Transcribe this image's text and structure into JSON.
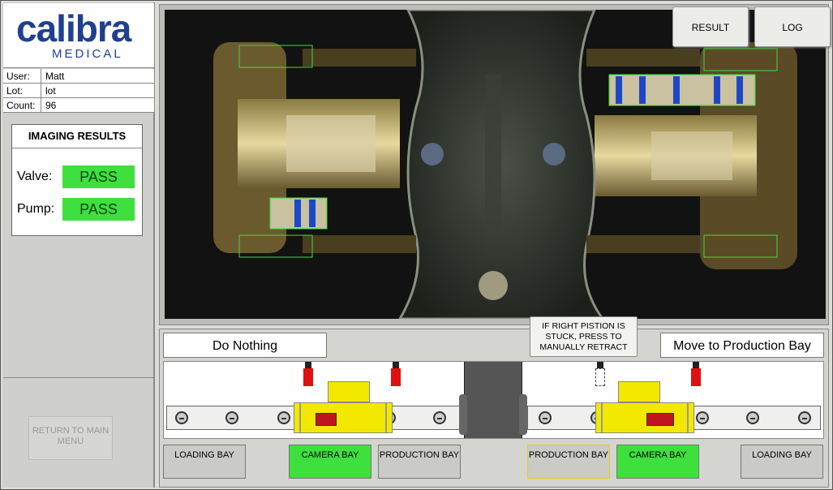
{
  "brand": {
    "name": "calibra",
    "sub": "MEDICAL"
  },
  "info": [
    {
      "key": "User:",
      "value": "Matt"
    },
    {
      "key": "Lot:",
      "value": "lot"
    },
    {
      "key": "Count:",
      "value": "96"
    }
  ],
  "imaging": {
    "title": "IMAGING RESULTS",
    "valve_label": "Valve:",
    "valve_status": "PASS",
    "pump_label": "Pump:",
    "pump_status": "PASS"
  },
  "return_button": "RETURN TO MAIN MENU",
  "camera_buttons": {
    "result": "RESULT",
    "log": "LOG"
  },
  "actions": {
    "left": "Do Nothing",
    "right": "Move to Production Bay",
    "retract_tip": "IF RIGHT PISTION IS STUCK, PRESS TO MANUALLY RETRACT"
  },
  "bays": {
    "left_loading": "LOADING BAY",
    "left_camera": "CAMERA BAY",
    "left_production": "PRODUCTION BAY",
    "right_production": "PRODUCTION BAY",
    "right_camera": "CAMERA BAY",
    "right_loading": "LOADING BAY"
  },
  "colors": {
    "pass": "#3de03d",
    "brand": "#1f3f91",
    "sensor_active": "#e01010",
    "carriage": "#f2e800"
  }
}
